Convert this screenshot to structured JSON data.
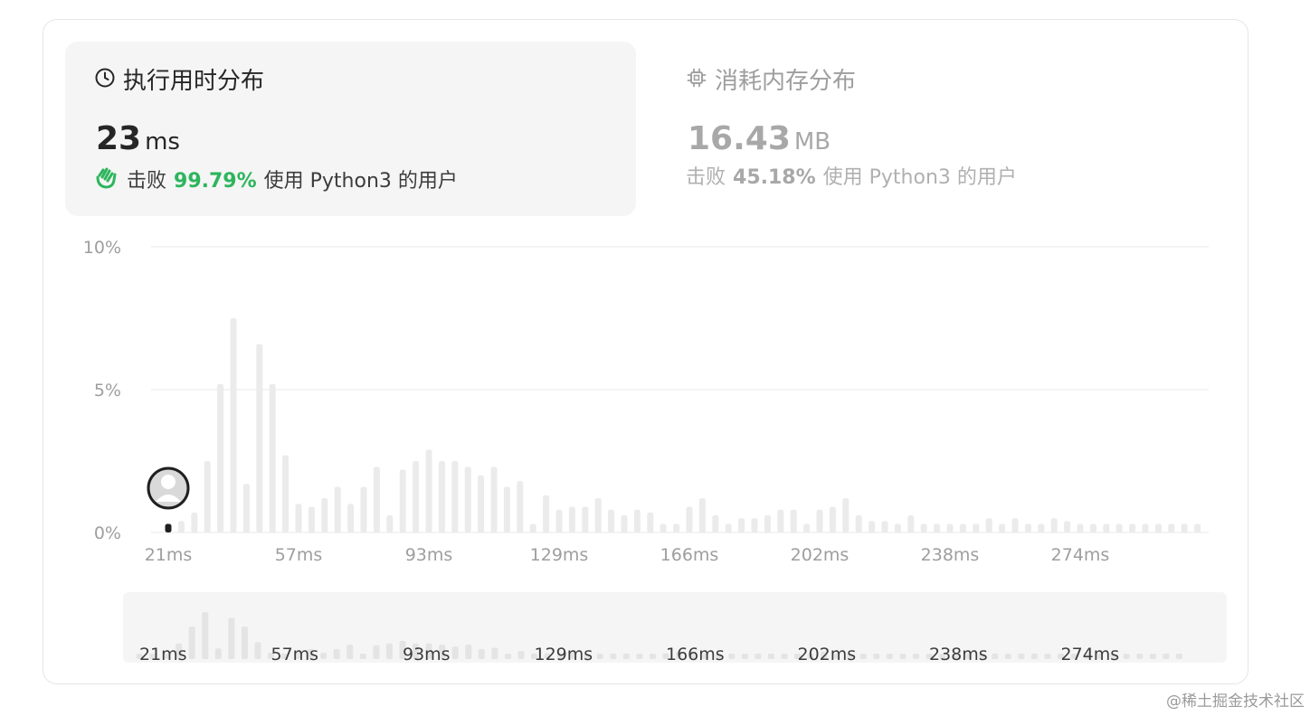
{
  "runtime": {
    "title": "执行用时分布",
    "value": "23",
    "unit": "ms",
    "beats_prefix": "击败",
    "beats_percent": "99.79%",
    "beats_suffix": "使用 Python3 的用户",
    "icon": "clock-icon",
    "accent": "#2db55d"
  },
  "memory": {
    "title": "消耗内存分布",
    "value": "16.43",
    "unit": "MB",
    "beats_prefix": "击败",
    "beats_percent": "45.18%",
    "beats_suffix": "使用 Python3 的用户",
    "icon": "chip-icon"
  },
  "watermark": "@稀土掘金技术社区",
  "chart_data": {
    "type": "bar",
    "title": "",
    "xlabel": "",
    "ylabel": "",
    "ylim": [
      0,
      10
    ],
    "y_ticks": [
      "10%",
      "5%",
      "0%"
    ],
    "y_tick_values": [
      10,
      5,
      0
    ],
    "x_tick_labels": [
      "21ms",
      "57ms",
      "93ms",
      "129ms",
      "166ms",
      "202ms",
      "238ms",
      "274ms"
    ],
    "x_tick_bar_index": [
      0,
      10,
      20,
      30,
      40,
      50,
      60,
      70
    ],
    "highlight_bar_index": 0,
    "bar_color": "#ebebeb",
    "highlight_color": "#1f1f1f",
    "grid": true,
    "values": [
      0.3,
      0.4,
      0.7,
      2.5,
      5.2,
      7.5,
      1.7,
      6.6,
      5.2,
      2.7,
      1.0,
      0.9,
      1.2,
      1.6,
      1.0,
      1.6,
      2.3,
      0.6,
      2.2,
      2.5,
      2.9,
      2.5,
      2.5,
      2.3,
      2.0,
      2.3,
      1.6,
      1.8,
      0.3,
      1.3,
      0.8,
      0.9,
      0.9,
      1.2,
      0.8,
      0.6,
      0.8,
      0.7,
      0.3,
      0.3,
      0.9,
      1.2,
      0.6,
      0.3,
      0.5,
      0.5,
      0.6,
      0.8,
      0.8,
      0.3,
      0.8,
      0.9,
      1.2,
      0.6,
      0.4,
      0.4,
      0.3,
      0.6,
      0.3,
      0.3,
      0.3,
      0.3,
      0.3,
      0.5,
      0.3,
      0.5,
      0.3,
      0.3,
      0.5,
      0.4,
      0.3,
      0.3,
      0.3,
      0.3,
      0.3,
      0.3,
      0.3,
      0.3,
      0.3,
      0.3
    ]
  }
}
